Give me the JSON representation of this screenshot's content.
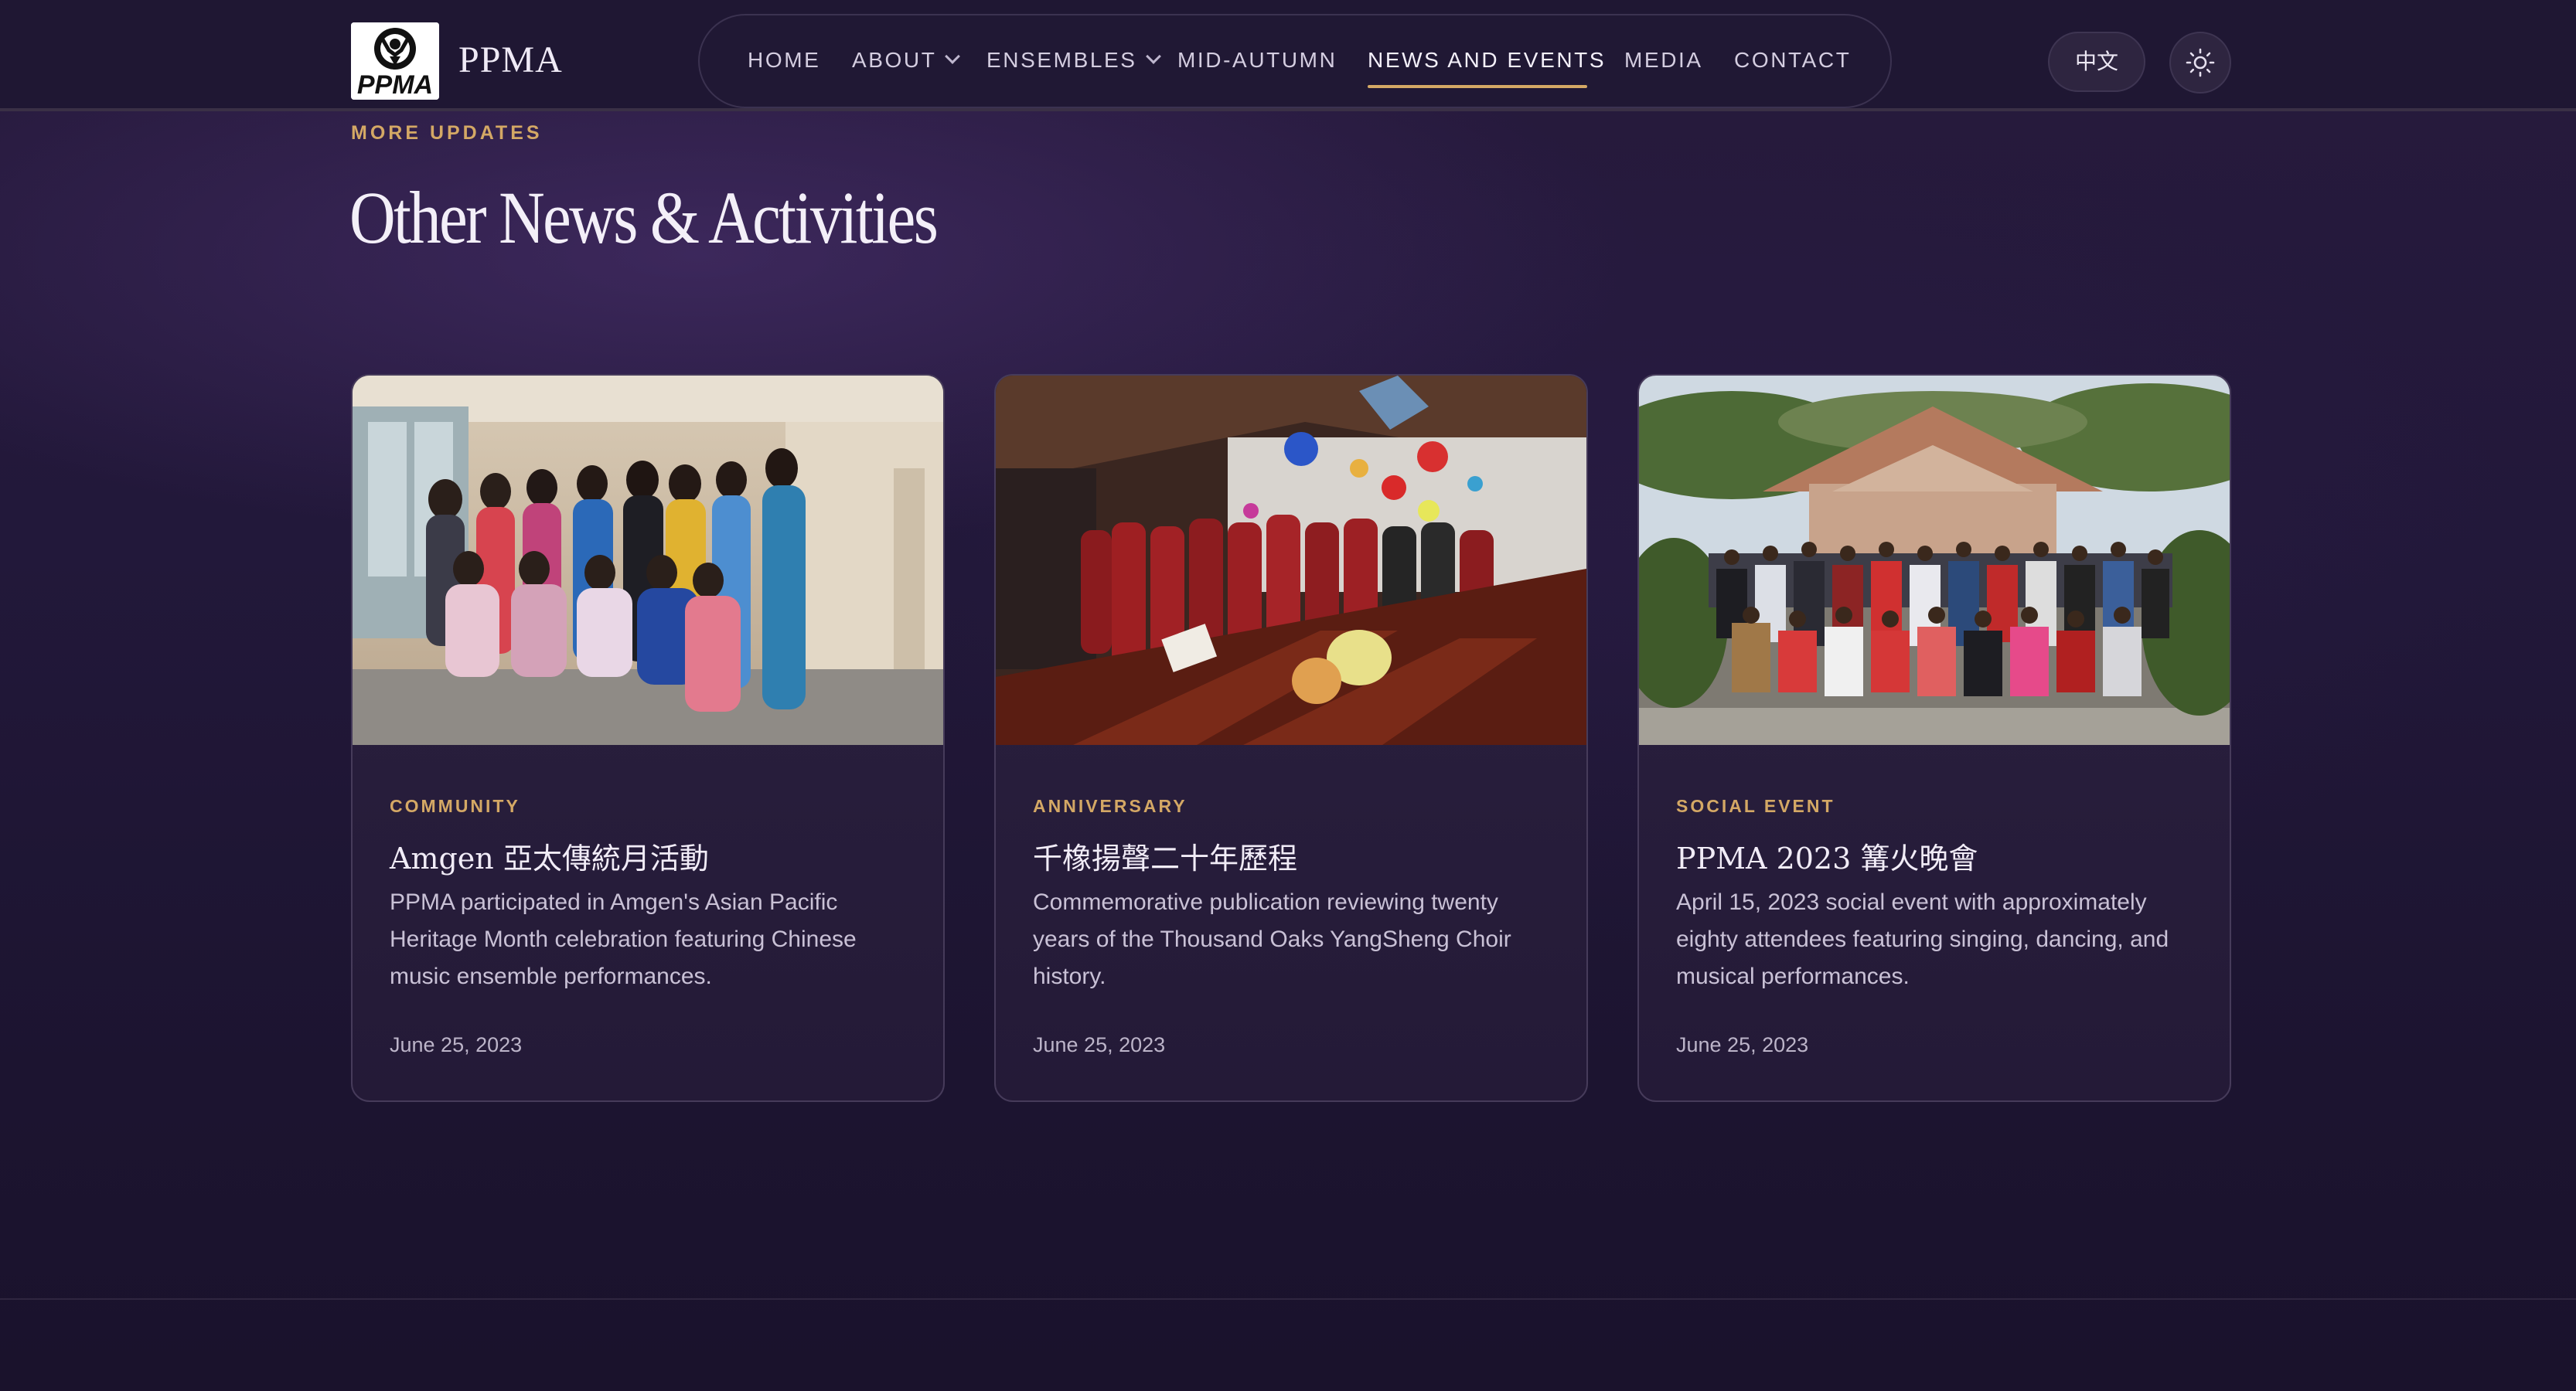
{
  "header": {
    "brand": "PPMA",
    "logo_text": "PPMA",
    "nav": [
      {
        "label": "HOME",
        "dropdown": false
      },
      {
        "label": "ABOUT",
        "dropdown": true
      },
      {
        "label": "ENSEMBLES",
        "dropdown": true
      },
      {
        "label": "MID-AUTUMN",
        "dropdown": false
      },
      {
        "label": "NEWS AND EVENTS",
        "dropdown": false,
        "active": true
      },
      {
        "label": "MEDIA",
        "dropdown": false
      },
      {
        "label": "CONTACT",
        "dropdown": false
      }
    ],
    "language_button": "中文",
    "theme_icon": "sun-icon"
  },
  "section": {
    "eyebrow": "MORE UPDATES",
    "title": "Other News & Activities"
  },
  "cards": [
    {
      "category": "COMMUNITY",
      "title": "Amgen 亞太傳統月活動",
      "description": "PPMA participated in Amgen's Asian Pacific Heritage Month celebration featuring Chinese music ensemble performances.",
      "date": "June 25, 2023"
    },
    {
      "category": "ANNIVERSARY",
      "title": "千橡揚聲二十年歷程",
      "description": "Commemorative publication reviewing twenty years of the Thousand Oaks YangSheng Choir history.",
      "date": "June 25, 2023"
    },
    {
      "category": "SOCIAL EVENT",
      "title": "PPMA 2023 篝火晚會",
      "description": "April 15, 2023 social event with approximately eighty attendees featuring singing, dancing, and musical performances.",
      "date": "June 25, 2023"
    }
  ],
  "colors": {
    "background": "#1d1430",
    "accent": "#d4a865",
    "card_border": "#463b5a"
  }
}
